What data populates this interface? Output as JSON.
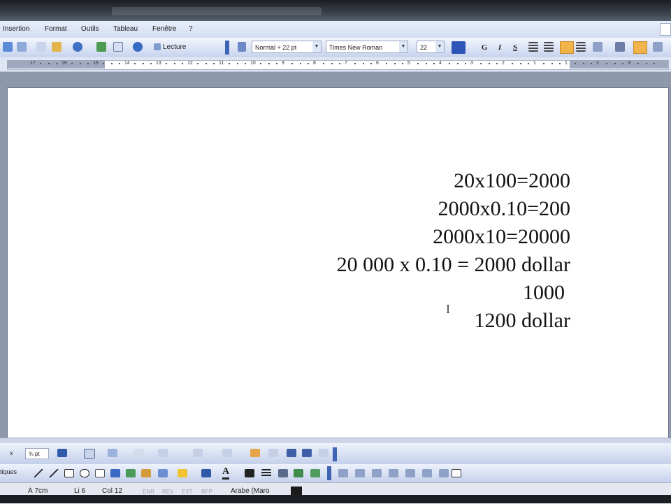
{
  "menu": {
    "items": [
      "Insertion",
      "Format",
      "Outils",
      "Tableau",
      "Fenêtre",
      "?"
    ]
  },
  "toolbar": {
    "reading_label": "Lecture",
    "style_value": "Normal + 22 pt",
    "font_value": "Times New Roman",
    "size_value": "22",
    "bold_label": "G",
    "italic_label": "I",
    "underline_label": "S",
    "highlight_color": "#f0b44a"
  },
  "ruler": {
    "numbers": [
      "17",
      "16",
      "15",
      "14",
      "13",
      "12",
      "11",
      "10",
      "9",
      "8",
      "7",
      "6",
      "5",
      "4",
      "3",
      "2",
      "1",
      "1",
      "2",
      "3"
    ]
  },
  "document": {
    "lines": [
      "20x100=2000",
      "2000x0.10=200",
      "2000x10=20000",
      "20 000 x 0.10 = 2000 dollar",
      "1000",
      "1200 dollar"
    ]
  },
  "drawing": {
    "line_width": "¾ pt",
    "shapes_label": "tiques"
  },
  "status": {
    "position": "À 7cm",
    "line": "Li 6",
    "col": "Col 12",
    "modes": [
      "ENR",
      "REV",
      "EXT",
      "RFP"
    ],
    "language": "Arabe (Maro"
  }
}
